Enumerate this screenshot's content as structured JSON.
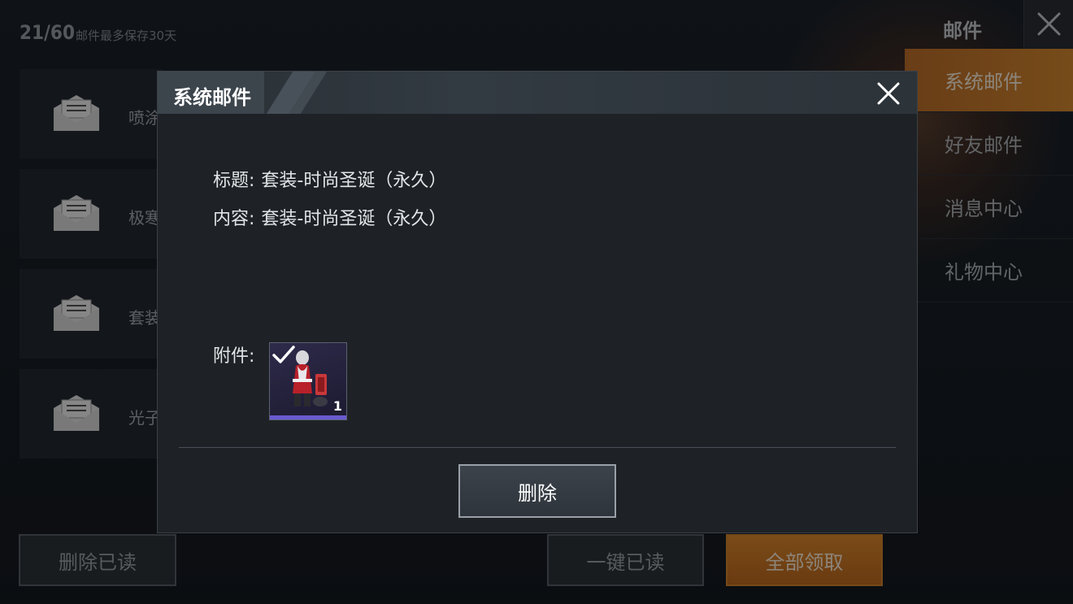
{
  "header": {
    "mail_count": "21/60",
    "keep_note": "邮件最多保存30天",
    "title": "邮件"
  },
  "tabs": [
    {
      "label": "系统邮件",
      "active": true
    },
    {
      "label": "好友邮件",
      "active": false
    },
    {
      "label": "消息中心",
      "active": false
    },
    {
      "label": "礼物中心",
      "active": false
    }
  ],
  "mail_list": [
    {
      "title": "喷涂"
    },
    {
      "title": "极寒"
    },
    {
      "title": "套装"
    },
    {
      "title": "光子"
    }
  ],
  "bottom_buttons": {
    "delete_read": "删除已读",
    "read_all": "一键已读",
    "claim_all": "全部领取"
  },
  "modal": {
    "title": "系统邮件",
    "subject_label": "标题:",
    "subject_value": "套装-时尚圣诞（永久）",
    "content_label": "内容:",
    "content_value": "套装-时尚圣诞（永久）",
    "attachment_label": "附件:",
    "attachment_quantity": "1",
    "attachment_claimed": true,
    "delete_label": "删除"
  },
  "colors": {
    "accent_orange": "#d88a30",
    "rarity_purple": "#6a5ad0"
  }
}
